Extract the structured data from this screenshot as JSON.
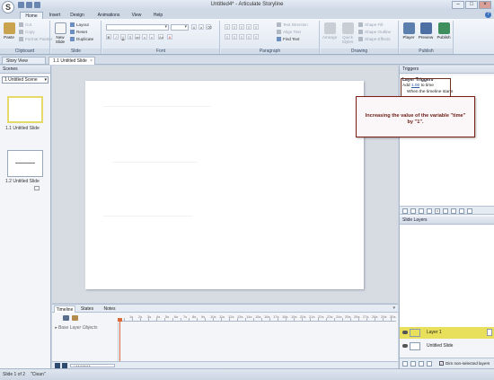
{
  "app": {
    "logo_letter": "S",
    "title": "Untitled4* - Articulate Storyline",
    "window_controls": [
      "–",
      "□",
      "×"
    ]
  },
  "tabs": [
    "Home",
    "Insert",
    "Design",
    "Animations",
    "View",
    "Help"
  ],
  "active_tab": "Home",
  "ribbon": {
    "clipboard": {
      "label": "Clipboard",
      "paste": "Paste",
      "cut": "Cut",
      "copy": "Copy",
      "format_painter": "Format Painter"
    },
    "slide": {
      "label": "Slide",
      "new_slide": "New Slide",
      "layout": "Layout",
      "reset": "Reset",
      "duplicate": "Duplicate"
    },
    "font": {
      "label": "Font"
    },
    "paragraph": {
      "label": "Paragraph",
      "text_direction": "Text Direction",
      "align_text": "Align Text",
      "find_text": "Find Text"
    },
    "drawing": {
      "label": "Drawing",
      "arrange": "Arrange",
      "quick_styles": "Quick Styles",
      "shape_fill": "Shape Fill",
      "shape_outline": "Shape Outline",
      "shape_effects": "Shape Effects"
    },
    "publish": {
      "label": "Publish",
      "player": "Player",
      "preview": "Preview",
      "publish": "Publish"
    }
  },
  "doc_tabs": {
    "story_view": "Story View",
    "slide": "1.1 Untitled Slide"
  },
  "scenes": {
    "header": "Scenes",
    "selected_scene": "1 Untitled Scene",
    "slides": [
      {
        "label": "1.1 Untitled Slide",
        "selected": true
      },
      {
        "label": "1.2 Untitled Slide",
        "selected": false
      }
    ]
  },
  "timeline": {
    "tabs": [
      "Timeline",
      "States",
      "Notes"
    ],
    "active_tab": "Timeline",
    "base_layer": "Base Layer Objects",
    "ruler_marks": [
      "1s",
      "2s",
      "3s",
      "4s",
      "5s",
      "6s",
      "7s",
      "8s",
      "9s",
      "10s",
      "11s",
      "12s",
      "13s",
      "14s",
      "15s",
      "16s",
      "17s",
      "18s",
      "19s",
      "20s",
      "21s",
      "22s",
      "23s",
      "24s",
      "25s",
      "26s",
      "27s",
      "28s",
      "29s",
      "30s"
    ]
  },
  "triggers": {
    "header": "Triggers",
    "title": "Layer Triggers",
    "action_prefix": "Add",
    "action_value": "1.00",
    "action_suffix": "to time",
    "condition": "When the timeline starts"
  },
  "slide_layers": {
    "header": "Slide Layers",
    "layers": [
      {
        "name": "Layer 1",
        "selected": true
      },
      {
        "name": "Untitled Slide",
        "selected": false
      }
    ],
    "dim_label": "Dim non-selected layers"
  },
  "callout": {
    "text": "Increasing the value of the variable \"time\" by \"1\"."
  },
  "status": {
    "slide_count": "Slide 1 of 2",
    "theme": "\"Clean\""
  },
  "colors": {
    "accent_yellow": "#e8e05a",
    "callout_border": "#7a1d14",
    "playhead": "#d86a3c"
  }
}
